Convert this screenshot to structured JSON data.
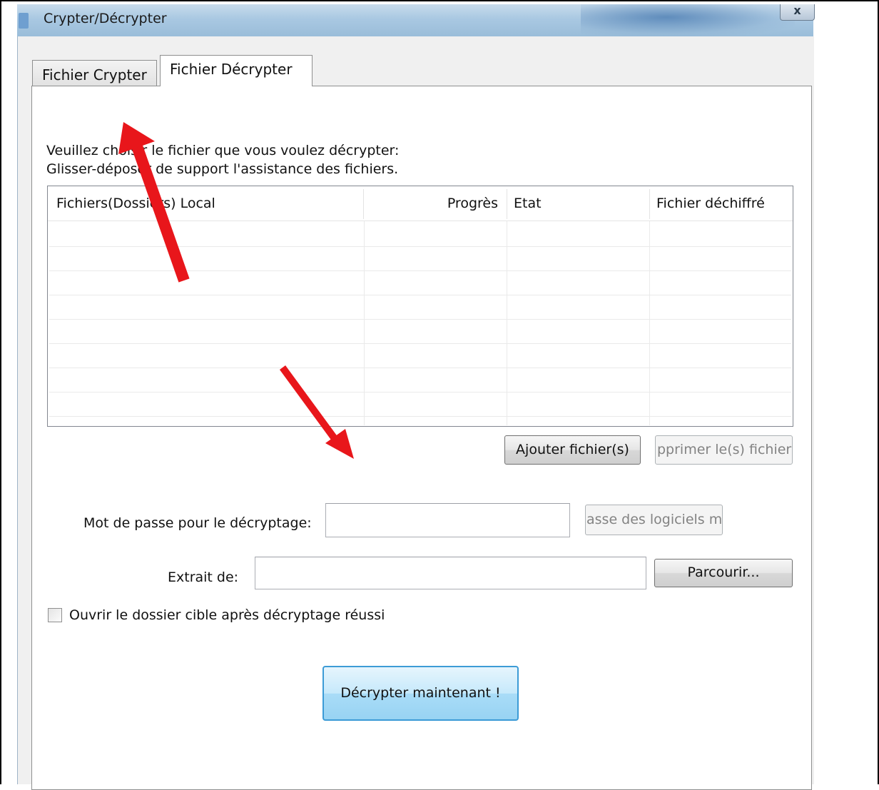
{
  "window": {
    "title": "Crypter/Décrypter",
    "close_glyph": "x"
  },
  "tabs": [
    {
      "label": "Fichier Crypter",
      "active": false
    },
    {
      "label": "Fichier Décrypter",
      "active": true
    }
  ],
  "instructions": {
    "line1": "Veuillez choisir le fichier que vous voulez décrypter:",
    "line2": "Glisser-déposer de support l'assistance des fichiers."
  },
  "file_list": {
    "columns": [
      "Fichiers(Dossiers) Local",
      "Progrès",
      "Etat",
      "Fichier déchiffré"
    ],
    "rows": []
  },
  "buttons": {
    "add_files": "Ajouter fichier(s)",
    "remove_files": "pprimer le(s) fichier(",
    "software_password": "asse des logiciels ma",
    "browse": "Parcourir...",
    "decrypt_now": "Décrypter maintenant !"
  },
  "password": {
    "label": "Mot de passe pour le décryptage:",
    "value": ""
  },
  "extract": {
    "label": "Extrait de:",
    "value": ""
  },
  "open_folder": {
    "label": "Ouvrir le dossier cible après décryptage réussi",
    "checked": false
  },
  "annotations": {
    "arrow_color": "#e8161b"
  },
  "icons": {
    "app": "app-icon",
    "close": "close-icon",
    "checkbox": "checkbox-icon"
  }
}
